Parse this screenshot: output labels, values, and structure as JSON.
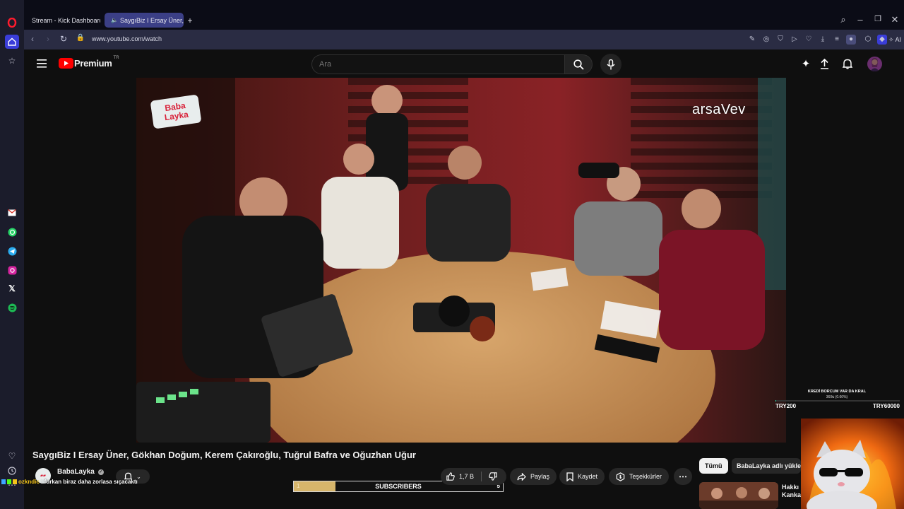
{
  "browser": {
    "tabs": [
      {
        "label": "Stream - Kick Dashboard",
        "icon": "kick-logo-icon",
        "active": false
      },
      {
        "label": "SaygıBiz I Ersay Üner,",
        "icon": "youtube-logo-icon",
        "active": true
      }
    ],
    "url": "www.youtube.com/watch",
    "ai_label": "AI"
  },
  "youtube": {
    "logo_text": "Premium",
    "logo_region": "TR",
    "search_placeholder": "Ara"
  },
  "video": {
    "watermark_left": "Baba Layka",
    "watermark_right": "arsaVev",
    "title": "SaygıBiz I Ersay Üner, Gökhan Doğum, Kerem Çakıroğlu, Tuğrul Bafra ve Oğuzhan Uğur"
  },
  "channel": {
    "name": "BabaLayka",
    "verified": true
  },
  "actions": {
    "like_count": "1,7 B",
    "share_label": "Paylaş",
    "save_label": "Kaydet",
    "thanks_label": "Teşekkürler"
  },
  "chips": {
    "all_label": "Tümü",
    "channel_label": "BabaLayka adlı yükley"
  },
  "related": {
    "title_line1": "Hakkı",
    "title_line2": "Kanka"
  },
  "overlay": {
    "goal_title": "KREDİ BORCUM VAR DA KRAL",
    "goal_progress": "360₺ (0.60%)",
    "goal_progress_fraction": 0.006,
    "goal_min": "TRY200",
    "goal_max": "TRY60000",
    "chat_user": "ozkndic",
    "chat_message": ": furkan biraz daha zorlasa sıçacaktı",
    "subscribers_label": "SUBSCRIBERS",
    "subscribers_left": "1",
    "subscribers_right": "5",
    "subscribers_fraction": 0.2
  },
  "colors": {
    "youtube_red": "#ff0000",
    "kick_green": "#53fc18",
    "opera_red": "#ff1b2d",
    "sub_bar_fill": "#d6b56b",
    "goal_bar": "#2ad4a3"
  }
}
